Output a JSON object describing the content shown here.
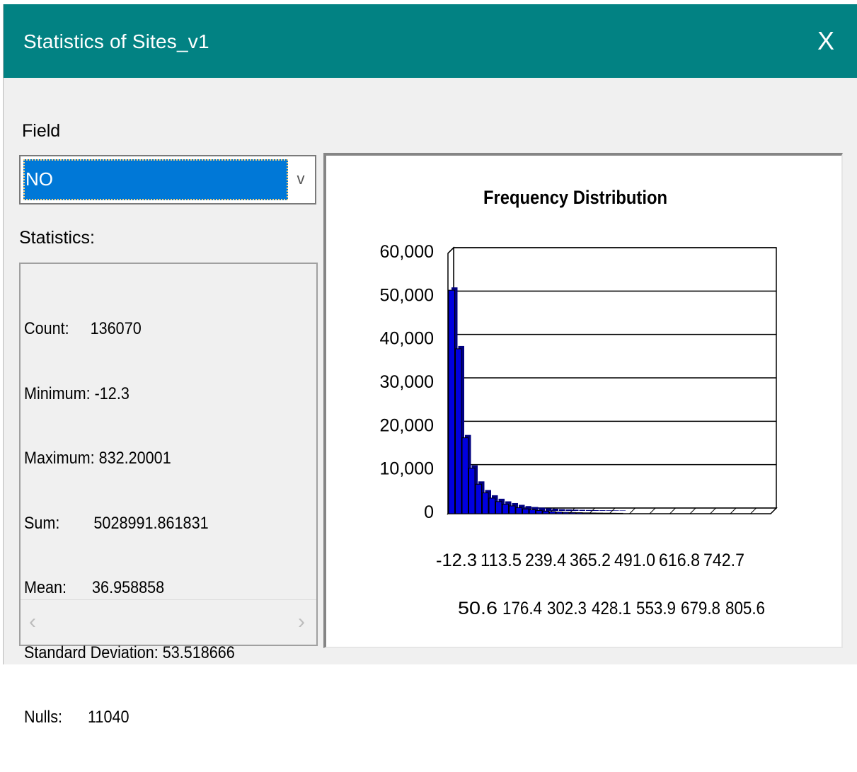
{
  "window": {
    "title": "Statistics of Sites_v1",
    "close_glyph": "X"
  },
  "field": {
    "label": "Field",
    "selected": "NO",
    "arrow_glyph": "v"
  },
  "statistics": {
    "label": "Statistics:",
    "lines": [
      "Count:     136070",
      "Minimum: -12.3",
      "Maximum: 832.20001",
      "Sum:        5028991.861831",
      "Mean:      36.958858",
      "Standard Deviation: 53.518666",
      "Nulls:      11040"
    ],
    "scroll_left_glyph": "‹",
    "scroll_right_glyph": "›"
  },
  "chart_data": {
    "type": "bar",
    "title": "Frequency Distribution",
    "xlabel": "",
    "ylabel": "",
    "ylim": [
      0,
      60000
    ],
    "yticks": [
      "60,000",
      "50,000",
      "40,000",
      "30,000",
      "20,000",
      "10,000",
      "0"
    ],
    "xticks_row1": [
      "-12.3",
      "113.5",
      "239.4",
      "365.2",
      "491.0",
      "616.8",
      "742.7"
    ],
    "xticks_row2": [
      "50.6",
      "176.4",
      "302.3",
      "428.1",
      "553.9",
      "679.8",
      "805.6"
    ],
    "values": [
      51500,
      38000,
      17500,
      10500,
      6800,
      4800,
      3600,
      2800,
      2200,
      1800,
      1400,
      1100,
      900,
      750,
      600,
      500,
      400,
      330,
      280,
      240,
      200,
      170,
      150,
      130,
      110,
      95,
      80,
      70,
      60,
      50,
      45,
      40,
      35,
      30,
      26,
      22,
      19,
      16,
      14,
      12,
      10,
      8,
      7,
      6,
      5,
      4,
      3,
      2
    ],
    "bar_color": "#0000e0",
    "grid": true,
    "legend": "none"
  }
}
